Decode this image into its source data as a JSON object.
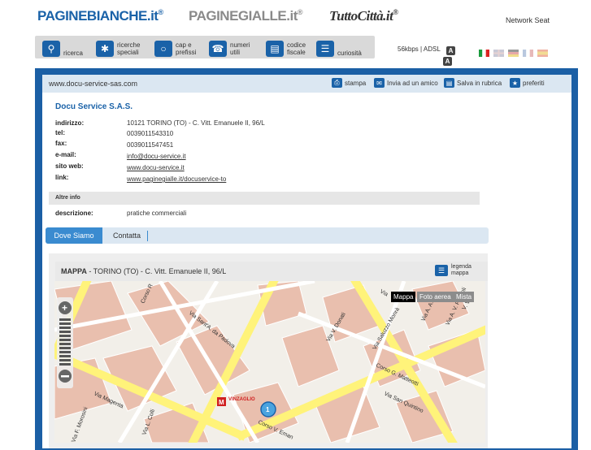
{
  "brands": {
    "paginebianche": "PAGINEBIANCHE.it",
    "paginegialle": "PAGINEGIALLE.it",
    "tuttocitta": "TuttoCittà.it",
    "network": "Network Seat"
  },
  "nav": {
    "items": [
      {
        "label": "ricerca",
        "icon": "search-icon"
      },
      {
        "label": "ricerche speciali",
        "icon": "puzzle-icon"
      },
      {
        "label": "cap e prefissi",
        "icon": "globe-icon"
      },
      {
        "label": "numeri utili",
        "icon": "phone-icon"
      },
      {
        "label": "codice fiscale",
        "icon": "card-icon"
      },
      {
        "label": "curiosità",
        "icon": "book-icon"
      }
    ],
    "speed": "56kbps | ADSL",
    "font_badge_1": "A",
    "font_badge_2": "A"
  },
  "toolbar": {
    "url": "www.docu-service-sas.com",
    "stampa": "stampa",
    "invia": "Invia ad un amico",
    "salva": "Salva in rubrica",
    "preferiti": "preferiti"
  },
  "company": {
    "name": "Docu Service S.A.S.",
    "fields": [
      {
        "label": "indirizzo:",
        "value": "10121 TORINO (TO) - C. Vitt. Emanuele II, 96/L"
      },
      {
        "label": "tel:",
        "value": "0039011543310"
      },
      {
        "label": "fax:",
        "value": "0039011547451"
      },
      {
        "label": "e-mail:",
        "value": "info@docu-service.it"
      },
      {
        "label": "sito web:",
        "value": "www.docu-service.it"
      },
      {
        "label": "link:",
        "value": "www.paginegialle.it/docuservice-to"
      }
    ],
    "altre_info": "Altre info",
    "descrizione_label": "descrizione:",
    "descrizione_value": "pratiche commerciali"
  },
  "tabs": {
    "dove_siamo": "Dove Siamo",
    "contatta": "Contatta"
  },
  "map": {
    "title_bold": "MAPPA",
    "title_rest": " - TORINO (TO) - C. Vitt. Emanuele II, 96/L",
    "legend_line1": "legenda",
    "legend_line2": "mappa",
    "types": [
      "Mappa",
      "Foto aerea",
      "Mista"
    ],
    "streets": [
      "Corso R",
      "Via Sant'A. da Padova",
      "Via Magenta",
      "Via F. Morosini",
      "Via L. Colli",
      "Corso V. Eman",
      "Via V. Donati",
      "Via Saluzzo Monrà",
      "Via A. A.",
      "Via A. V. Pascoli",
      "Corso G. Matteotti",
      "Via San Quintino",
      "Via",
      "V. Vela"
    ],
    "metro_label": "VINZAGLIO",
    "marker": "1"
  }
}
